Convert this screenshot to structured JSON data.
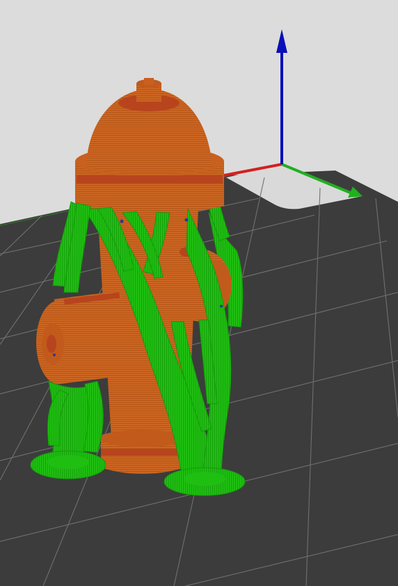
{
  "viewport": {
    "background": "#dcdcdc",
    "bed_color": "#3c3c3c",
    "grid_line_color": "#6e6e6e",
    "bed_corner_color": "#d9d9d9"
  },
  "axes": {
    "x_color": "#d42020",
    "y_color": "#20b020",
    "z_color": "#0a10b8"
  },
  "model": {
    "icon": "fire-hydrant-model",
    "body_color": "#cc6622",
    "band_color": "#b8441e"
  },
  "supports": {
    "icon": "tree-support-structure",
    "color": "#1fbf12"
  }
}
